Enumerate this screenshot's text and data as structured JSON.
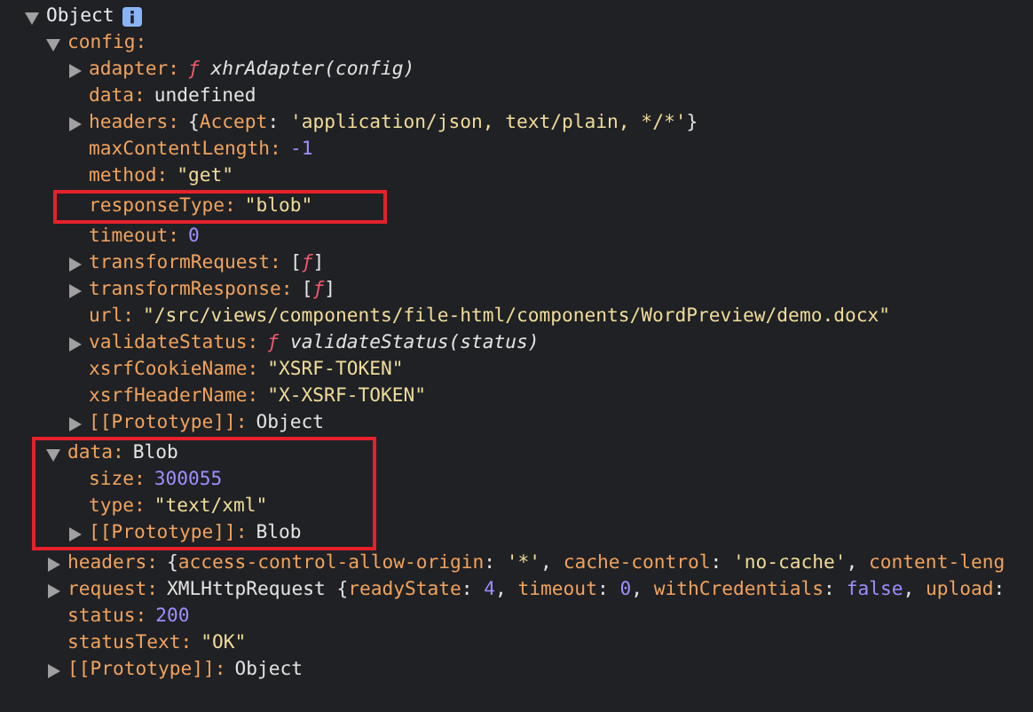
{
  "tree": {
    "label": "Object",
    "expanded": true,
    "children": [
      {
        "key": "config:",
        "expanded": true,
        "children": [
          {
            "key": "adapter:",
            "expanded": false,
            "highlighted": false,
            "value": [
              {
                "kind": "func",
                "text": "ƒ"
              },
              {
                "kind": "signature",
                "text": " xhrAdapter(config)"
              }
            ]
          },
          {
            "key": "data:",
            "highlighted": false,
            "value": [
              {
                "kind": "plain",
                "text": "undefined"
              }
            ]
          },
          {
            "key": "headers:",
            "expanded": false,
            "highlighted": false,
            "value": [
              {
                "kind": "plain",
                "text": "{"
              },
              {
                "kind": "key",
                "text": "Accept"
              },
              {
                "kind": "plain",
                "text": ": "
              },
              {
                "kind": "string",
                "text": "'application/json, text/plain, */*'"
              },
              {
                "kind": "plain",
                "text": "}"
              }
            ]
          },
          {
            "key": "maxContentLength:",
            "highlighted": false,
            "value": [
              {
                "kind": "number",
                "text": "-1"
              }
            ]
          },
          {
            "key": "method:",
            "highlighted": false,
            "value": [
              {
                "kind": "string",
                "text": "\"get\""
              }
            ]
          },
          {
            "key": "responseType:",
            "highlighted": true,
            "value": [
              {
                "kind": "string",
                "text": "\"blob\""
              }
            ]
          },
          {
            "key": "timeout:",
            "highlighted": false,
            "value": [
              {
                "kind": "number",
                "text": "0"
              }
            ]
          },
          {
            "key": "transformRequest:",
            "expanded": false,
            "highlighted": false,
            "value": [
              {
                "kind": "plain",
                "text": "["
              },
              {
                "kind": "func",
                "text": "ƒ"
              },
              {
                "kind": "plain",
                "text": "]"
              }
            ]
          },
          {
            "key": "transformResponse:",
            "expanded": false,
            "highlighted": false,
            "value": [
              {
                "kind": "plain",
                "text": "["
              },
              {
                "kind": "func",
                "text": "ƒ"
              },
              {
                "kind": "plain",
                "text": "]"
              }
            ]
          },
          {
            "key": "url:",
            "highlighted": false,
            "value": [
              {
                "kind": "string",
                "text": "\"/src/views/components/file-html/components/WordPreview/demo.docx\""
              }
            ]
          },
          {
            "key": "validateStatus:",
            "expanded": false,
            "highlighted": false,
            "value": [
              {
                "kind": "func",
                "text": "ƒ"
              },
              {
                "kind": "signature",
                "text": " validateStatus(status)"
              }
            ]
          },
          {
            "key": "xsrfCookieName:",
            "highlighted": false,
            "value": [
              {
                "kind": "string",
                "text": "\"XSRF-TOKEN\""
              }
            ]
          },
          {
            "key": "xsrfHeaderName:",
            "highlighted": false,
            "value": [
              {
                "kind": "string",
                "text": "\"X-XSRF-TOKEN\""
              }
            ]
          },
          {
            "key": "[[Prototype]]:",
            "expanded": false,
            "highlighted": false,
            "value": [
              {
                "kind": "plain",
                "text": "Object"
              }
            ]
          }
        ]
      },
      {
        "key": "data:",
        "expanded": true,
        "highlighted": true,
        "value": [
          {
            "kind": "plain",
            "text": "Blob"
          }
        ],
        "children": [
          {
            "key": "size:",
            "highlighted": false,
            "value": [
              {
                "kind": "number",
                "text": "300055"
              }
            ]
          },
          {
            "key": "type:",
            "highlighted": false,
            "value": [
              {
                "kind": "string",
                "text": "\"text/xml\""
              }
            ]
          },
          {
            "key": "[[Prototype]]:",
            "expanded": false,
            "highlighted": false,
            "value": [
              {
                "kind": "plain",
                "text": "Blob"
              }
            ]
          }
        ]
      },
      {
        "key": "headers:",
        "expanded": false,
        "highlighted": false,
        "value": [
          {
            "kind": "plain",
            "text": "{"
          },
          {
            "kind": "key",
            "text": "access-control-allow-origin"
          },
          {
            "kind": "plain",
            "text": ": "
          },
          {
            "kind": "string",
            "text": "'*'"
          },
          {
            "kind": "plain",
            "text": ", "
          },
          {
            "kind": "key",
            "text": "cache-control"
          },
          {
            "kind": "plain",
            "text": ": "
          },
          {
            "kind": "string",
            "text": "'no-cache'"
          },
          {
            "kind": "plain",
            "text": ", "
          },
          {
            "kind": "key",
            "text": "content-leng"
          }
        ]
      },
      {
        "key": "request:",
        "expanded": false,
        "highlighted": false,
        "value": [
          {
            "kind": "plain",
            "text": "XMLHttpRequest {"
          },
          {
            "kind": "key",
            "text": "readyState"
          },
          {
            "kind": "plain",
            "text": ": "
          },
          {
            "kind": "number",
            "text": "4"
          },
          {
            "kind": "plain",
            "text": ", "
          },
          {
            "kind": "key",
            "text": "timeout"
          },
          {
            "kind": "plain",
            "text": ": "
          },
          {
            "kind": "number",
            "text": "0"
          },
          {
            "kind": "plain",
            "text": ", "
          },
          {
            "kind": "key",
            "text": "withCredentials"
          },
          {
            "kind": "plain",
            "text": ": "
          },
          {
            "kind": "keyword",
            "text": "false"
          },
          {
            "kind": "plain",
            "text": ", "
          },
          {
            "kind": "key",
            "text": "upload"
          },
          {
            "kind": "plain",
            "text": ":"
          }
        ]
      },
      {
        "key": "status:",
        "highlighted": false,
        "value": [
          {
            "kind": "number",
            "text": "200"
          }
        ]
      },
      {
        "key": "statusText:",
        "highlighted": false,
        "value": [
          {
            "kind": "string",
            "text": "\"OK\""
          }
        ]
      },
      {
        "key": "[[Prototype]]:",
        "expanded": false,
        "highlighted": false,
        "value": [
          {
            "kind": "plain",
            "text": "Object"
          }
        ]
      }
    ]
  }
}
